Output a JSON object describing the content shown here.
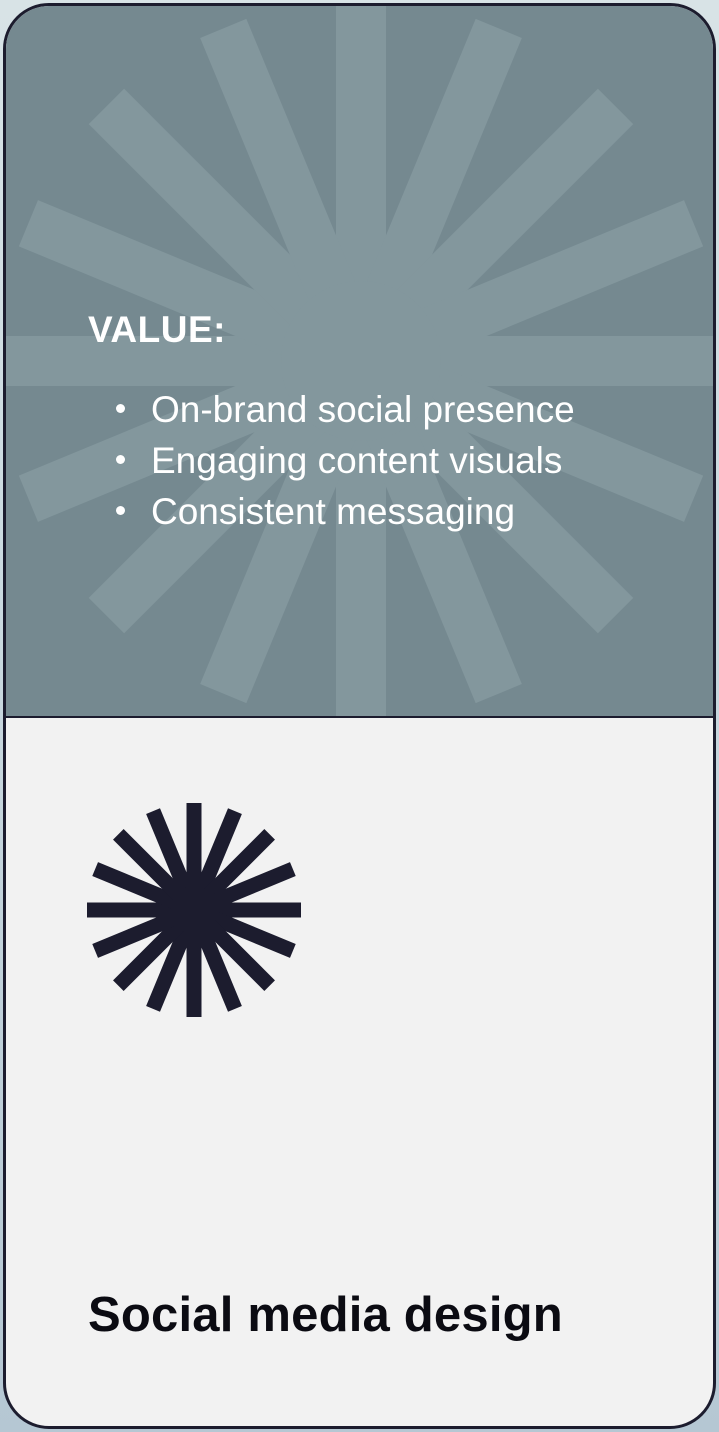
{
  "card": {
    "value_heading": "VALUE:",
    "value_items": [
      {
        "text": "On-brand social presence"
      },
      {
        "text": "Engaging content visuals"
      },
      {
        "text": "Consistent messaging"
      }
    ],
    "title": "Social media design",
    "icons": {
      "burst": "sunburst-icon",
      "watermark": "sunburst-watermark-icon"
    }
  },
  "colors": {
    "top_panel": "#758990",
    "bottom_panel": "#f2f2f2",
    "border": "#1c1c2e",
    "icon": "#1c1c2e",
    "title_text": "#0b0b12",
    "value_text": "#ffffff"
  }
}
